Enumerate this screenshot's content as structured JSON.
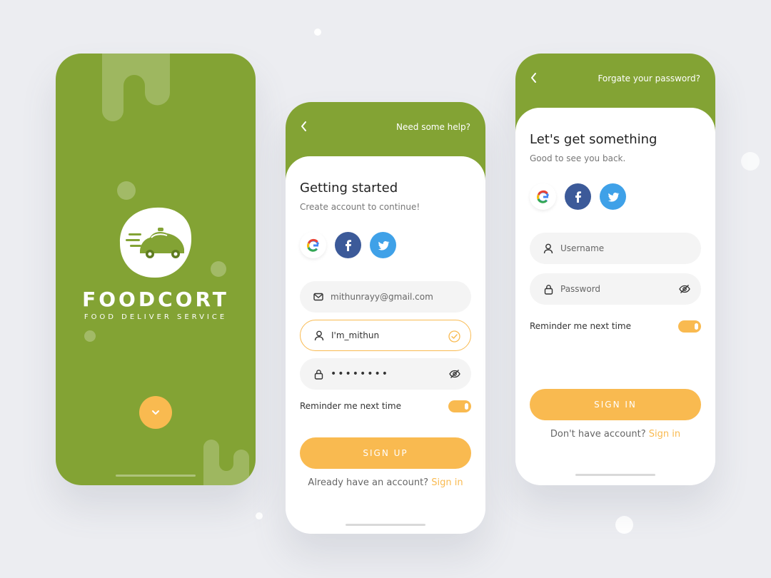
{
  "colors": {
    "green": "#83a334",
    "accent": "#f9ba50",
    "facebook": "#3c5a99",
    "twitter": "#3fa1e8"
  },
  "splash": {
    "brand": "FOODCORT",
    "tagline": "FOOD DELIVER SERVICE",
    "logo_icon": "food-delivery-car-icon",
    "next_icon": "chevron-down-icon"
  },
  "signup": {
    "help_link": "Need some help?",
    "title": "Getting started",
    "subtitle": "Create account to continue!",
    "email_value": "mithunrayy@gmail.com",
    "username_value": "I'm_mithun",
    "password_value": "••••••••",
    "remember_label": "Reminder me next time",
    "button_label": "SIGN UP",
    "footer_text": "Already have an account?",
    "footer_link": "Sign in"
  },
  "signin": {
    "help_link": "Forgate your password?",
    "title": "Let's get something",
    "subtitle": "Good to see you back.",
    "username_placeholder": "Username",
    "password_placeholder": "Password",
    "remember_label": "Reminder me next time",
    "button_label": "SIGN IN",
    "footer_text": "Don't have account?",
    "footer_link": "Sign in"
  }
}
